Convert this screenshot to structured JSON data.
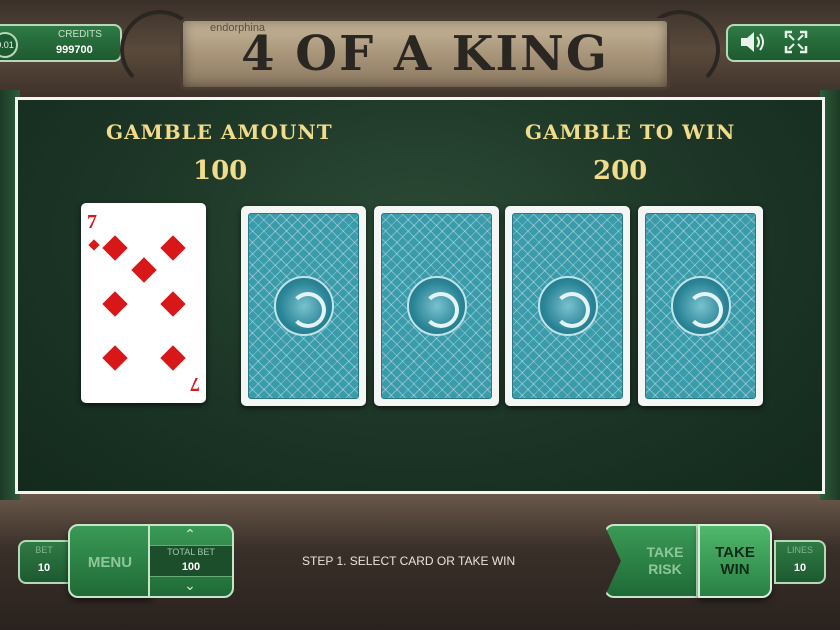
{
  "header": {
    "title": "4 OF A KING",
    "brand_small": "endorphina",
    "credits_label": "CREDITS",
    "credits_value": "999700",
    "credits_circle": "0.01"
  },
  "gamble": {
    "amount_label": "GAMBLE AMOUNT",
    "amount_value": "100",
    "win_label": "GAMBLE TO WIN",
    "win_value": "200"
  },
  "dealer_card": {
    "rank": "7",
    "suit": "diamonds"
  },
  "face_down_cards": 4,
  "bottom": {
    "bet_label": "BET",
    "bet_value": "10",
    "menu_label": "MENU",
    "total_bet_label": "TOTAL BET",
    "total_bet_value": "100",
    "status": "STEP 1. SELECT CARD OR TAKE WIN",
    "take_risk_label_1": "TAKE",
    "take_risk_label_2": "RISK",
    "take_win_label_1": "TAKE",
    "take_win_label_2": "WIN",
    "lines_label": "LINES",
    "lines_value": "10"
  },
  "icons": {
    "sound": "speaker-icon",
    "fullscreen": "fullscreen-icon",
    "arrow_up": "chevron-up-icon",
    "arrow_down": "chevron-down-icon"
  },
  "colors": {
    "gold_text": "#f0dc8a",
    "table_green": "#1c3526",
    "button_green": "#2f7a45",
    "card_back": "#3a9bab",
    "suit_red": "#d81818"
  }
}
